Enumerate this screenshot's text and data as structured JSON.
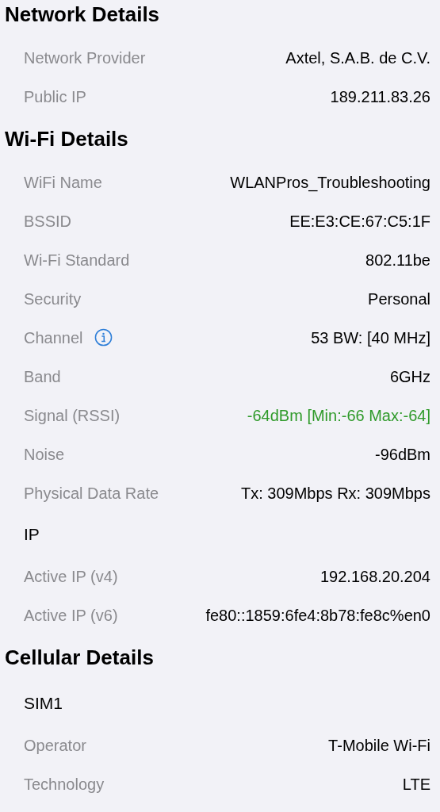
{
  "sections": [
    {
      "title": "Network Details",
      "items": [
        {
          "kind": "row",
          "label": "Network Provider",
          "value": "Axtel, S.A.B. de C.V."
        },
        {
          "kind": "row",
          "label": "Public IP",
          "value": "189.211.83.26"
        }
      ]
    },
    {
      "title": "Wi-Fi Details",
      "items": [
        {
          "kind": "row",
          "label": "WiFi Name",
          "value": "WLANPros_Troubleshooting"
        },
        {
          "kind": "row",
          "label": "BSSID",
          "value": "EE:E3:CE:67:C5:1F"
        },
        {
          "kind": "row",
          "label": "Wi-Fi Standard",
          "value": "802.11be"
        },
        {
          "kind": "row",
          "label": "Security",
          "value": "Personal"
        },
        {
          "kind": "row",
          "label": "Channel",
          "value": "53 BW: [40 MHz]",
          "info": true
        },
        {
          "kind": "row",
          "label": "Band",
          "value": "6GHz"
        },
        {
          "kind": "row",
          "label": "Signal (RSSI)",
          "value": "-64dBm [Min:-66 Max:-64]",
          "color": "#2f9a2a"
        },
        {
          "kind": "row",
          "label": "Noise",
          "value": "-96dBm"
        },
        {
          "kind": "row",
          "label": "Physical Data Rate",
          "value": "Tx: 309Mbps Rx: 309Mbps"
        },
        {
          "kind": "subheader",
          "label": "IP"
        },
        {
          "kind": "row",
          "label": "Active IP (v4)",
          "value": "192.168.20.204"
        },
        {
          "kind": "row",
          "label": "Active IP (v6)",
          "value": "fe80::1859:6fe4:8b78:fe8c%en0"
        }
      ]
    },
    {
      "title": "Cellular Details",
      "items": [
        {
          "kind": "subheader",
          "label": "SIM1"
        },
        {
          "kind": "row",
          "label": "Operator",
          "value": "T-Mobile Wi-Fi"
        },
        {
          "kind": "row",
          "label": "Technology",
          "value": "LTE"
        }
      ]
    }
  ]
}
